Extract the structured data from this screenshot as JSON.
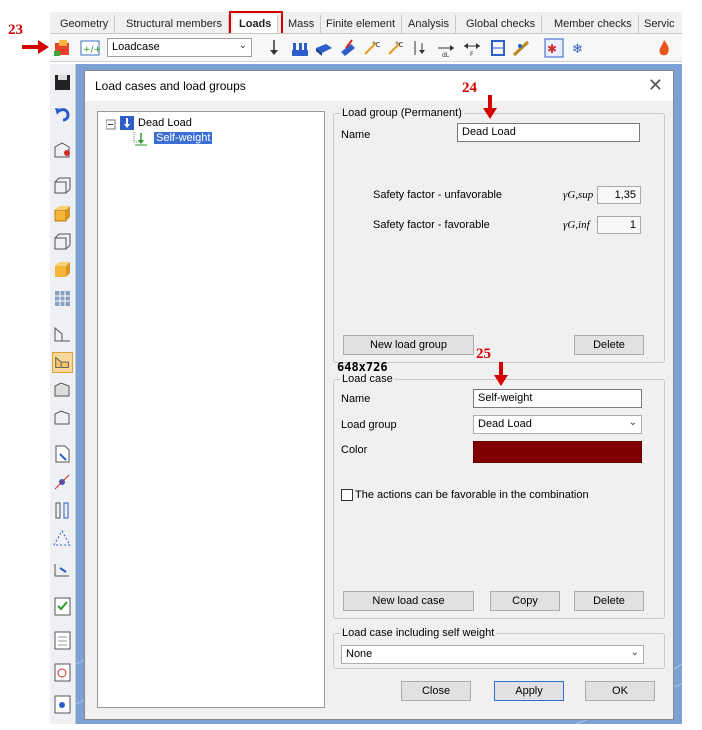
{
  "annotations": {
    "n23": "23",
    "n24": "24",
    "n25": "25",
    "size_label": "648x726"
  },
  "ribbon": {
    "tabs": [
      "Geometry",
      "Structural members",
      "Loads",
      "Mass",
      "Finite element",
      "Analysis",
      "Global checks",
      "Member checks",
      "Servic"
    ],
    "active": "Loads"
  },
  "toolbar": {
    "loadcase_combo": "Loadcase"
  },
  "dialog": {
    "title": "Load cases and load groups",
    "tree": {
      "root": "Dead Load",
      "child": "Self-weight"
    },
    "load_group": {
      "legend": "Load group (Permanent)",
      "name_label": "Name",
      "name_value": "Dead Load",
      "sf_unfav_label": "Safety factor - unfavorable",
      "sf_unfav_symbol": "γG,sup",
      "sf_unfav_value": "1,35",
      "sf_fav_label": "Safety factor - favorable",
      "sf_fav_symbol": "γG,inf",
      "sf_fav_value": "1",
      "new_button": "New load group",
      "delete_button": "Delete"
    },
    "load_case": {
      "legend": "Load case",
      "name_label": "Name",
      "name_value": "Self-weight",
      "group_label": "Load group",
      "group_value": "Dead Load",
      "color_label": "Color",
      "color_hex": "#800000",
      "favorable_check": "The actions can be favorable in the combination",
      "new_button": "New load case",
      "copy_button": "Copy",
      "delete_button": "Delete"
    },
    "self_weight": {
      "legend": "Load case including self weight",
      "value": "None"
    },
    "footer": {
      "close": "Close",
      "apply": "Apply",
      "ok": "OK"
    }
  }
}
